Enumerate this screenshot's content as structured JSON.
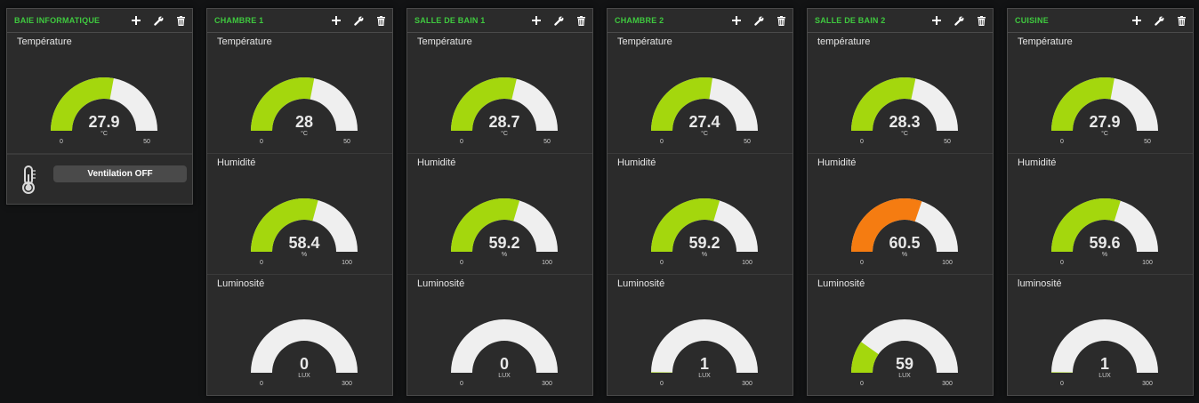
{
  "colors": {
    "green": "#a4d70d",
    "orange": "#f57c11",
    "track": "#efefef"
  },
  "icons": {
    "add": "plus-icon",
    "settings": "wrench-icon",
    "delete": "trash-icon",
    "indicator": "thermometer-icon"
  },
  "panes": [
    {
      "title": "BAIE INFORMATIQUE",
      "gauges": [
        {
          "title": "Température",
          "value": "27.9",
          "units": "°C",
          "min": "0",
          "max": "50",
          "color": "#a4d70d"
        }
      ],
      "indicator": {
        "label": "Ventilation OFF"
      }
    },
    {
      "title": "CHAMBRE 1",
      "gauges": [
        {
          "title": "Température",
          "value": "28",
          "units": "°C",
          "min": "0",
          "max": "50",
          "color": "#a4d70d"
        },
        {
          "title": "Humidité",
          "value": "58.4",
          "units": "%",
          "min": "0",
          "max": "100",
          "color": "#a4d70d"
        },
        {
          "title": "Luminosité",
          "value": "0",
          "units": "LUX",
          "min": "0",
          "max": "300",
          "color": "#a4d70d"
        }
      ]
    },
    {
      "title": "SALLE DE BAIN 1",
      "gauges": [
        {
          "title": "Température",
          "value": "28.7",
          "units": "°C",
          "min": "0",
          "max": "50",
          "color": "#a4d70d"
        },
        {
          "title": "Humidité",
          "value": "59.2",
          "units": "%",
          "min": "0",
          "max": "100",
          "color": "#a4d70d"
        },
        {
          "title": "Luminosité",
          "value": "0",
          "units": "LUX",
          "min": "0",
          "max": "300",
          "color": "#a4d70d"
        }
      ]
    },
    {
      "title": "CHAMBRE 2",
      "gauges": [
        {
          "title": "Température",
          "value": "27.4",
          "units": "°C",
          "min": "0",
          "max": "50",
          "color": "#a4d70d"
        },
        {
          "title": "Humidité",
          "value": "59.2",
          "units": "%",
          "min": "0",
          "max": "100",
          "color": "#a4d70d"
        },
        {
          "title": "Luminosité",
          "value": "1",
          "units": "LUX",
          "min": "0",
          "max": "300",
          "color": "#a4d70d"
        }
      ]
    },
    {
      "title": "SALLE DE BAIN 2",
      "gauges": [
        {
          "title": "température",
          "value": "28.3",
          "units": "°C",
          "min": "0",
          "max": "50",
          "color": "#a4d70d"
        },
        {
          "title": "Humidité",
          "value": "60.5",
          "units": "%",
          "min": "0",
          "max": "100",
          "color": "#f57c11"
        },
        {
          "title": "Luminosité",
          "value": "59",
          "units": "LUX",
          "min": "0",
          "max": "300",
          "color": "#a4d70d"
        }
      ]
    },
    {
      "title": "CUISINE",
      "gauges": [
        {
          "title": "Température",
          "value": "27.9",
          "units": "°C",
          "min": "0",
          "max": "50",
          "color": "#a4d70d"
        },
        {
          "title": "Humidité",
          "value": "59.6",
          "units": "%",
          "min": "0",
          "max": "100",
          "color": "#a4d70d"
        },
        {
          "title": "luminosité",
          "value": "1",
          "units": "LUX",
          "min": "0",
          "max": "300",
          "color": "#a4d70d"
        }
      ]
    }
  ]
}
